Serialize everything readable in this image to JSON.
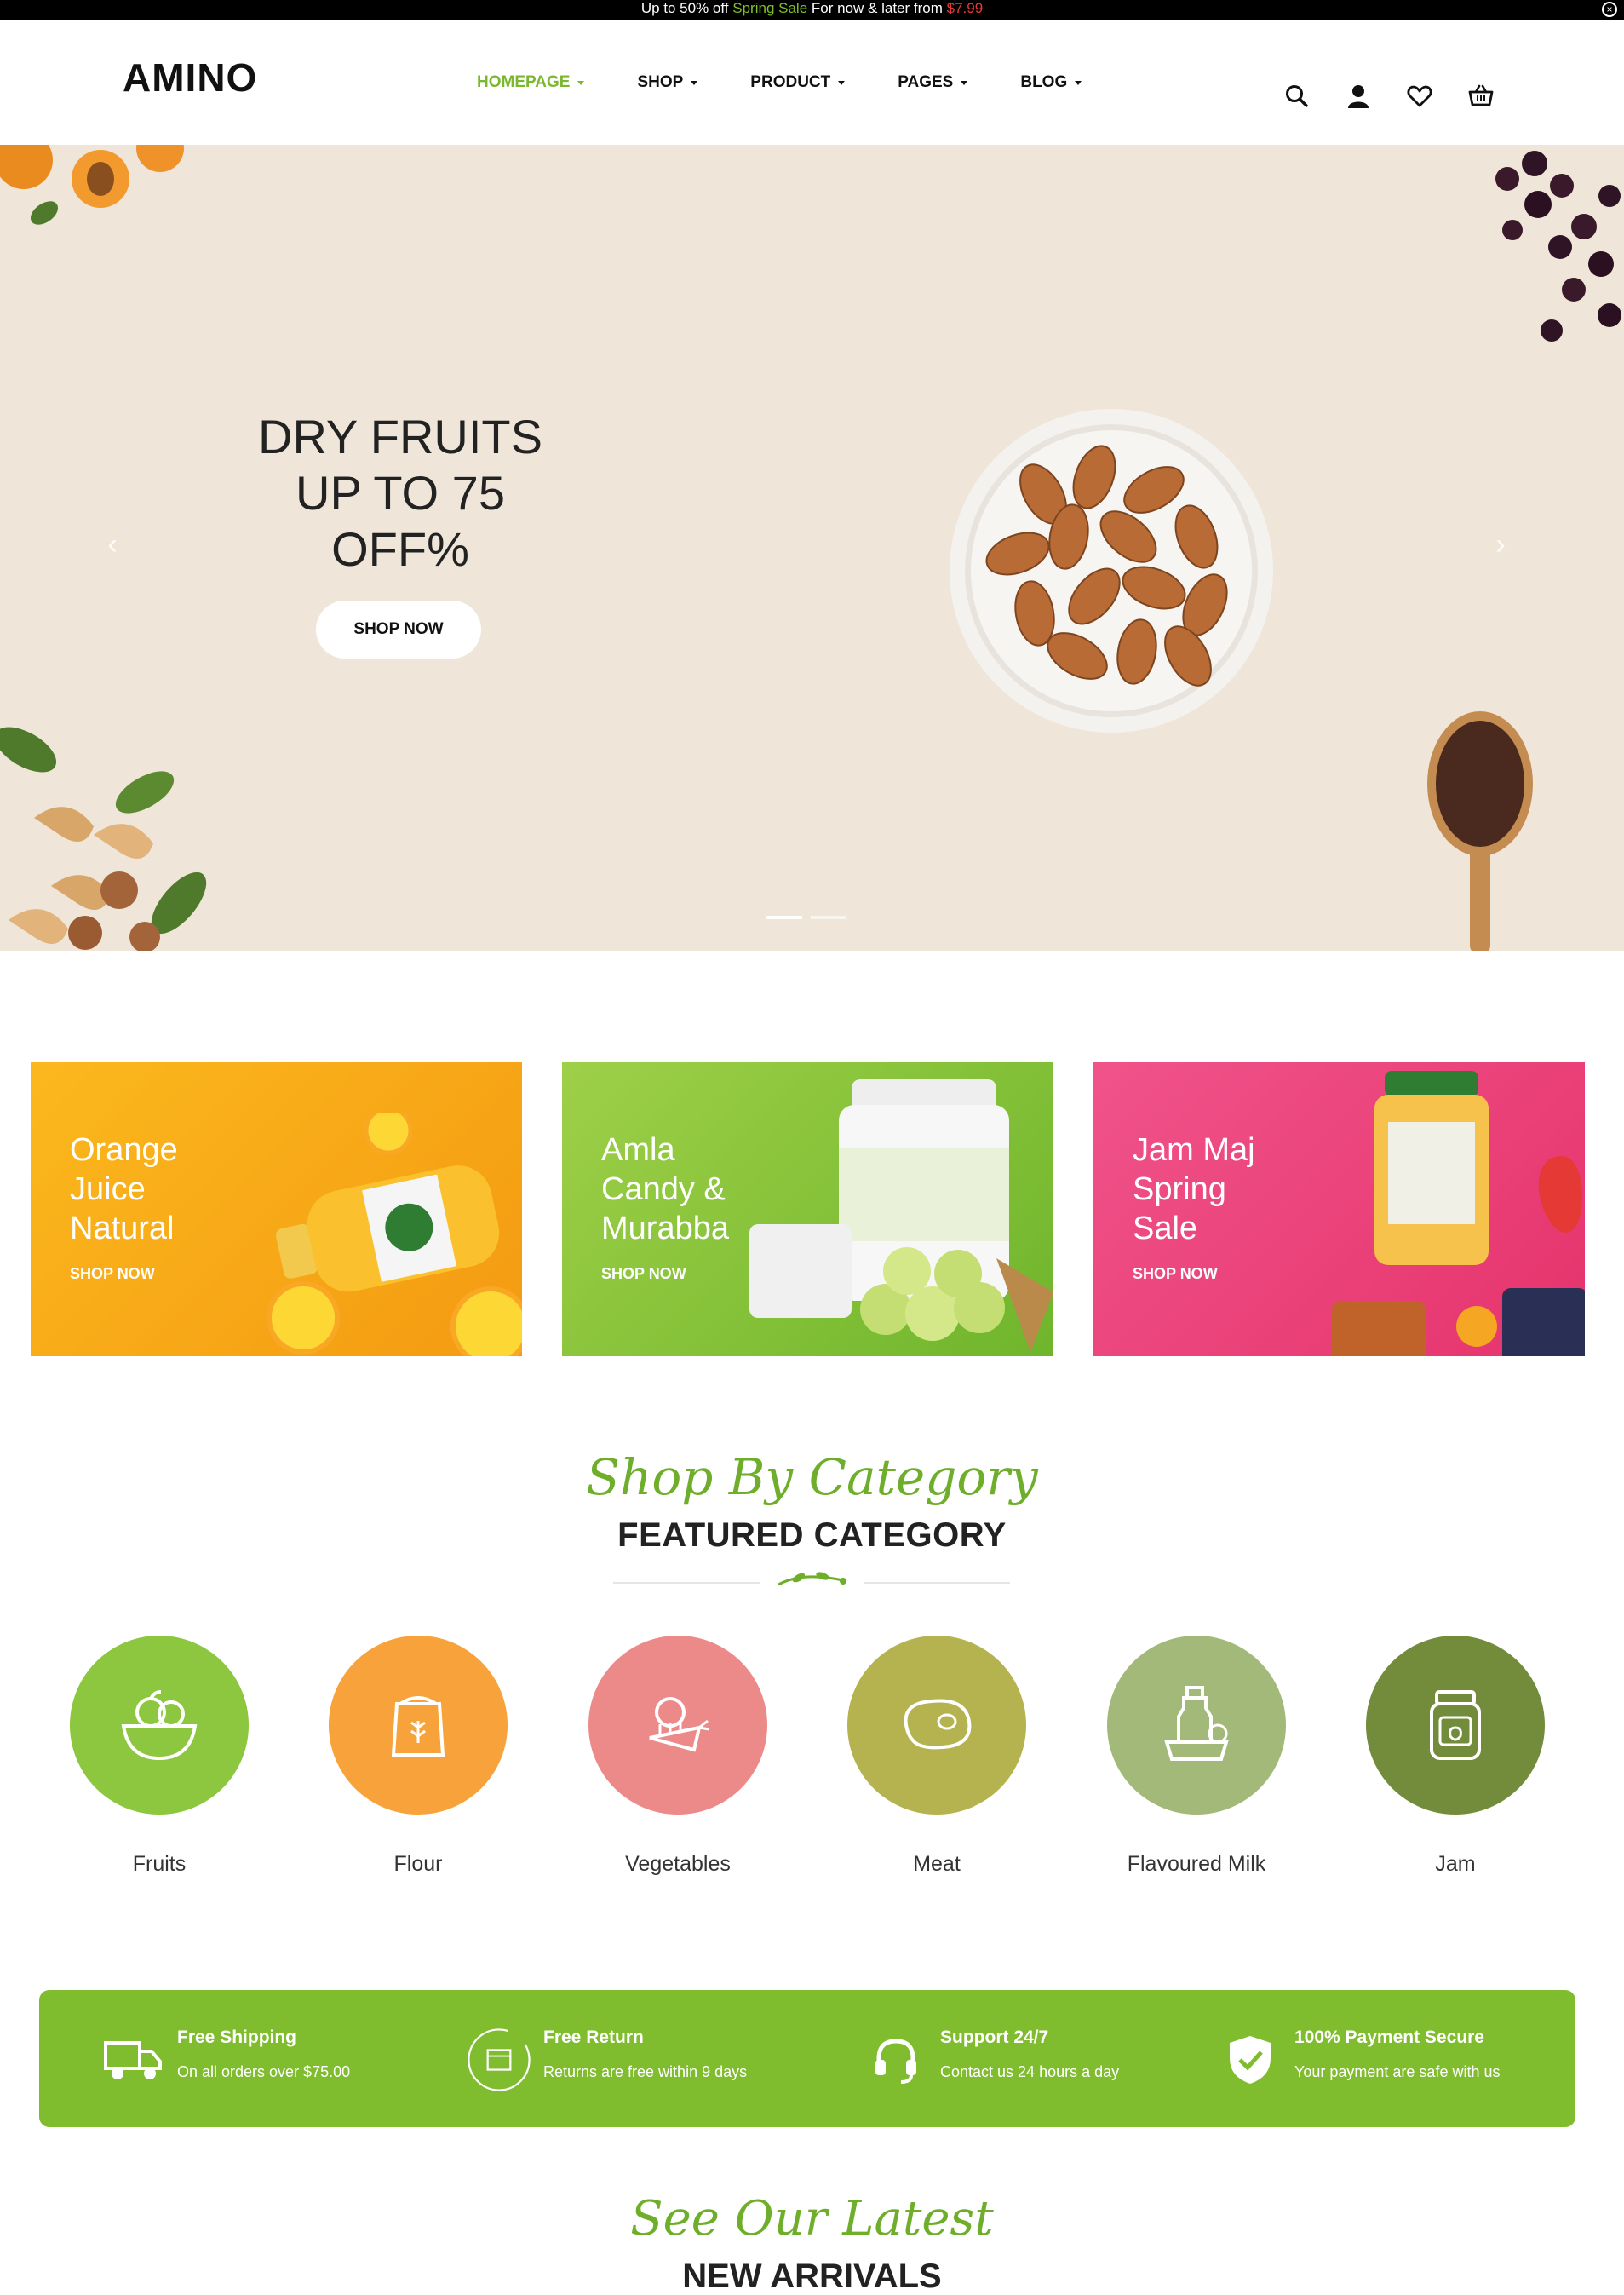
{
  "announcement": {
    "prefix": "Up to 50% off",
    "highlight": "Spring Sale",
    "middle": "For now & later from",
    "price": "$7.99"
  },
  "header": {
    "logo": "AMINO",
    "nav": [
      {
        "label": "HOMEPAGE"
      },
      {
        "label": "SHOP"
      },
      {
        "label": "PRODUCT"
      },
      {
        "label": "PAGES"
      },
      {
        "label": "BLOG"
      }
    ]
  },
  "hero": {
    "title_line1": "DRY FRUITS",
    "title_line2": "UP TO 75",
    "title_line3": "OFF%",
    "button": "SHOP NOW",
    "prev_arrow": "‹",
    "next_arrow": "›"
  },
  "banners": [
    {
      "line1": "Orange",
      "line2": "Juice",
      "line3": "Natural",
      "link": "SHOP NOW",
      "color": "#f7a21b"
    },
    {
      "line1": "Amla",
      "line2": "Candy &",
      "line3": "Murabba",
      "link": "SHOP NOW",
      "color": "#8cc63f"
    },
    {
      "line1": "Jam Maj",
      "line2": "Spring",
      "line3": "Sale",
      "link": "SHOP NOW",
      "color": "#ea3f78"
    }
  ],
  "category_section": {
    "script_title": "Shop By Category",
    "title": "FEATURED CATEGORY"
  },
  "categories": [
    {
      "name": "Fruits",
      "color": "#8dc63f",
      "icon": "fruit-basket-icon"
    },
    {
      "name": "Flour",
      "color": "#f7a23a",
      "icon": "flour-bag-icon"
    },
    {
      "name": "Vegetables",
      "color": "#ec8a8a",
      "icon": "vegetables-icon"
    },
    {
      "name": "Meat",
      "color": "#b5b34f",
      "icon": "steak-icon"
    },
    {
      "name": "Flavoured Milk",
      "color": "#a3b97a",
      "icon": "milk-bottle-icon"
    },
    {
      "name": "Jam",
      "color": "#738c3c",
      "icon": "jam-jar-icon"
    }
  ],
  "features": [
    {
      "title": "Free Shipping",
      "desc": "On all orders over $75.00",
      "icon": "truck-icon"
    },
    {
      "title": "Free Return",
      "desc": "Returns are free within 9 days",
      "icon": "return-box-icon"
    },
    {
      "title": "Support 24/7",
      "desc": "Contact us 24 hours a day",
      "icon": "headset-icon"
    },
    {
      "title": "100% Payment Secure",
      "desc": "Your payment are safe with us",
      "icon": "shield-check-icon"
    }
  ],
  "new_arrivals": {
    "script_title": "See Our Latest",
    "title": "NEW ARRIVALS"
  }
}
